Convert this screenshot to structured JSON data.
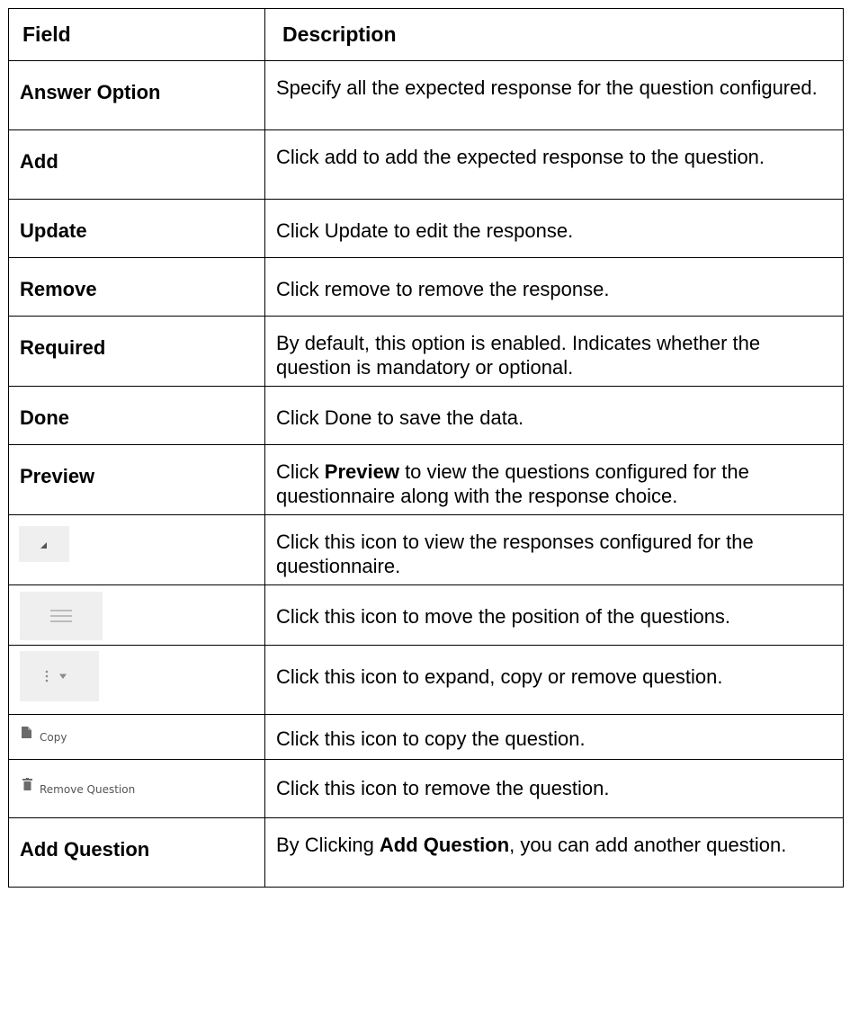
{
  "header": {
    "field": "Field",
    "description": "Description"
  },
  "rows": [
    {
      "field": "Answer Option",
      "desc": "Specify all the expected response for the question configured."
    },
    {
      "field": "Add",
      "desc": "Click add to add the expected response to the question."
    },
    {
      "field": "Update",
      "desc": "Click Update to edit the response."
    },
    {
      "field": "Remove",
      "desc": "Click remove to remove the response."
    },
    {
      "field": "Required",
      "desc": "By default, this option is enabled. Indicates whether the question is mandatory or optional."
    },
    {
      "field": "Done",
      "desc": "Click Done to save the data."
    },
    {
      "field": "Preview",
      "desc_pre": "Click ",
      "desc_bold": "Preview",
      "desc_post": " to view the questions configured for the questionnaire along with the response choice."
    },
    {
      "icon": "resize-corner-icon",
      "desc": "Click this icon to view the responses configured for the questionnaire."
    },
    {
      "icon": "drag-handle-icon",
      "desc": "Click this icon to move the position of the questions."
    },
    {
      "icon": "more-menu-icon",
      "desc": "Click this icon to expand, copy or remove question."
    },
    {
      "icon": "copy-icon",
      "icon_label": "Copy",
      "desc": "Click this icon to copy the question."
    },
    {
      "icon": "trash-icon",
      "icon_label": "Remove Question",
      "desc": "Click this icon to remove the question."
    },
    {
      "field": "Add Question",
      "desc_pre": "By Clicking ",
      "desc_bold": "Add Question",
      "desc_post": ", you can add another question."
    }
  ]
}
